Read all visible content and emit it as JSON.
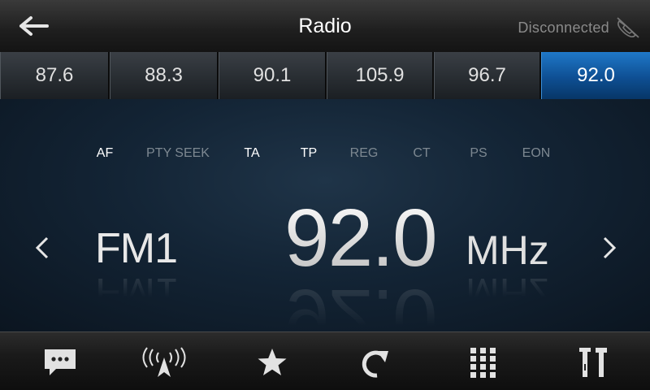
{
  "header": {
    "title": "Radio",
    "status": "Disconnected",
    "back_icon": "back-arrow-icon",
    "status_icon": "disconnected-phone-icon"
  },
  "presets": [
    {
      "label": "87.6",
      "active": false
    },
    {
      "label": "88.3",
      "active": false
    },
    {
      "label": "90.1",
      "active": false
    },
    {
      "label": "105.9",
      "active": false
    },
    {
      "label": "96.7",
      "active": false
    },
    {
      "label": "92.0",
      "active": true
    }
  ],
  "flags": [
    {
      "label": "AF",
      "on": true
    },
    {
      "label": "PTY SEEK",
      "on": false
    },
    {
      "label": "TA",
      "on": true
    },
    {
      "label": "TP",
      "on": true
    },
    {
      "label": "REG",
      "on": false
    },
    {
      "label": "CT",
      "on": false
    },
    {
      "label": "PS",
      "on": false
    },
    {
      "label": "EON",
      "on": false
    }
  ],
  "tuner": {
    "band": "FM1",
    "frequency": "92.0",
    "unit": "MHz"
  },
  "toolbar": [
    {
      "icon": "message-icon"
    },
    {
      "icon": "antenna-icon"
    },
    {
      "icon": "star-icon"
    },
    {
      "icon": "refresh-icon"
    },
    {
      "icon": "grid-keypad-icon"
    },
    {
      "icon": "tools-settings-icon"
    }
  ],
  "colors": {
    "accent": "#1f78c8",
    "background": "#0b1520",
    "flag_off": "#7d8891",
    "flag_on": "#ffffff"
  }
}
